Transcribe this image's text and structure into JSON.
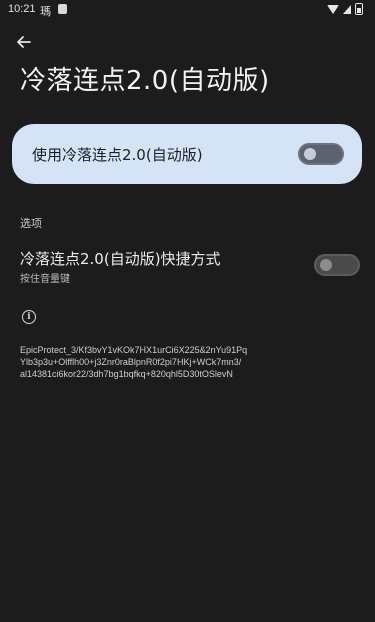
{
  "status_bar": {
    "time": "10:21",
    "notification_glyph": "瑪",
    "icons": [
      "wifi-icon",
      "cell-signal-icon",
      "battery-icon"
    ]
  },
  "header": {
    "back_icon": "arrow-left-icon",
    "title": "冷落连点2.0(自动版)"
  },
  "main_toggle": {
    "label": "使用冷落连点2.0(自动版)",
    "enabled": false
  },
  "options": {
    "section_title": "选项",
    "shortcut": {
      "title": "冷落连点2.0(自动版)快捷方式",
      "subtitle": "按住音量键",
      "enabled": false
    }
  },
  "info": {
    "icon": "info-icon",
    "icon_glyph": "i",
    "text": "EpicProtect_3/Kf3bvY1vKOk7HX1urCi6X225&2nYu91Pq\nYlb3p3u+Olfflh00+j3Znr0raBlpnR0f2pi7HKj+WCk7mn3/\nal14381ci6kor22/3dh7bg1bqfkq+820qhl5D30tOSlevN"
  },
  "colors": {
    "background": "#1c1c1c",
    "card_background": "#d5e3f7",
    "text_primary": "#ececec"
  }
}
